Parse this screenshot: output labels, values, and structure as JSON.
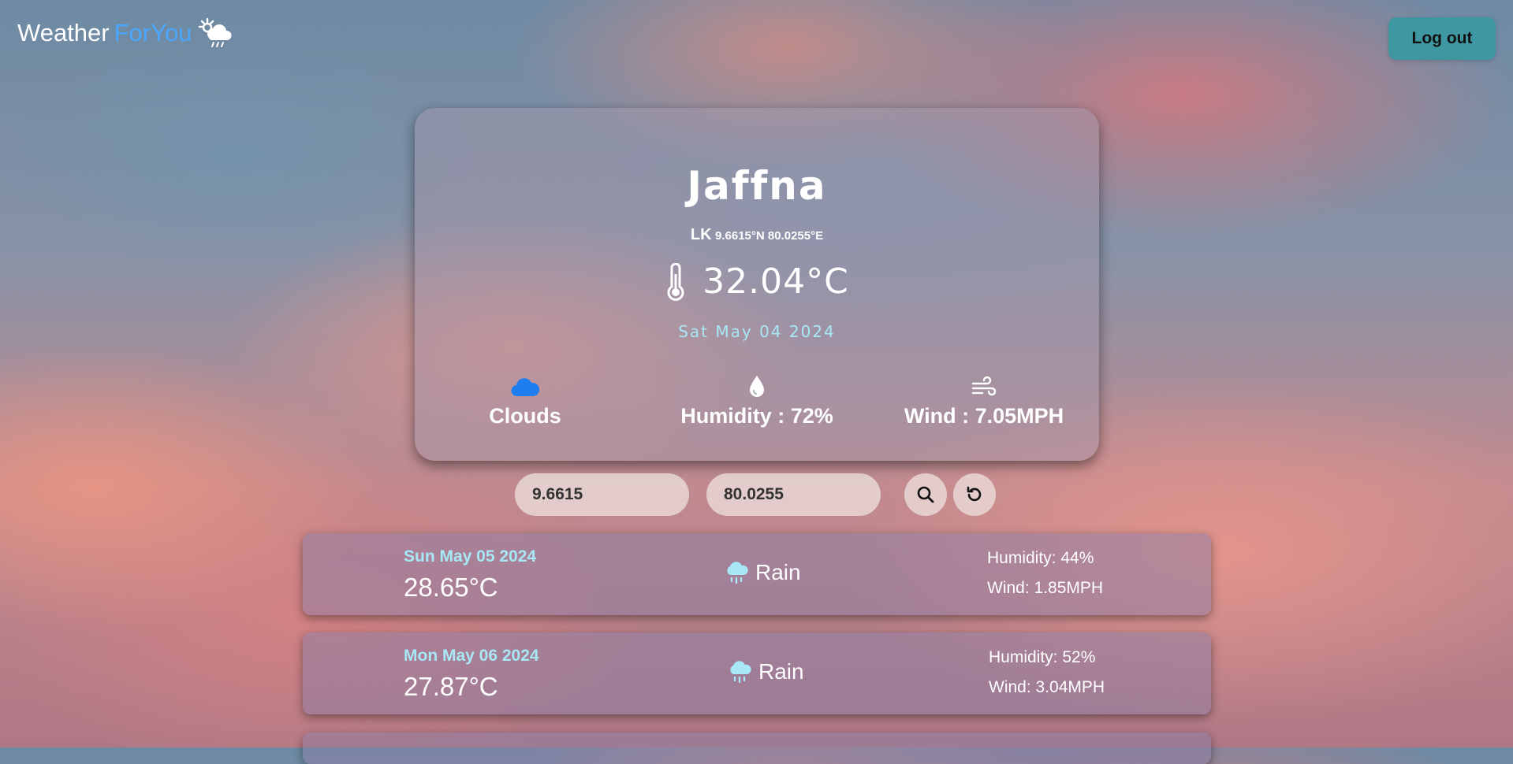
{
  "brand": {
    "name_part1": "Weather",
    "name_part2": "ForYou",
    "icon": "weather-sun-cloud-rain-icon"
  },
  "header": {
    "logout_label": "Log out"
  },
  "current": {
    "city": "Jaffna",
    "country": "LK",
    "coords_text": "9.6615°N 80.0255°E",
    "temperature": "32.04°C",
    "date": "Sat May 04 2024",
    "condition": "Clouds",
    "humidity": "Humidity : 72%",
    "wind": "Wind : 7.05MPH"
  },
  "search": {
    "lat_value": "9.6615",
    "lon_value": "80.0255"
  },
  "forecast": [
    {
      "date": "Sun May 05 2024",
      "temp": "28.65°C",
      "condition": "Rain",
      "humidity": "Humidity: 44%",
      "wind": "Wind: 1.85MPH"
    },
    {
      "date": "Mon May 06 2024",
      "temp": "27.87°C",
      "condition": "Rain",
      "humidity": "Humidity: 52%",
      "wind": "Wind: 3.04MPH"
    }
  ],
  "colors": {
    "accent": "#4aa7ff",
    "date": "#a8e8f6",
    "logout_bg": "#3f97a2",
    "cloud_icon": "#1e7ef0"
  }
}
